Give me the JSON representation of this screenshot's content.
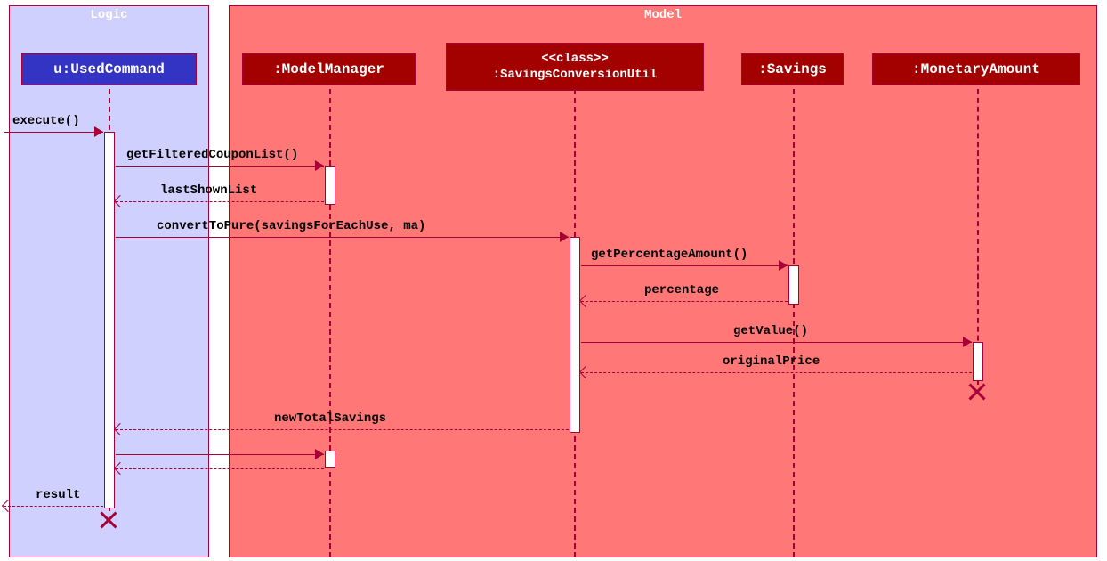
{
  "boxes": {
    "logic": {
      "title": "Logic"
    },
    "model": {
      "title": "Model"
    }
  },
  "participants": {
    "usedCommand": "u:UsedCommand",
    "modelManager": ":ModelManager",
    "savingsConvUtilStereo": "<<class>>",
    "savingsConvUtil": ":SavingsConversionUtil",
    "savings": ":Savings",
    "monetaryAmount": ":MonetaryAmount"
  },
  "messages": {
    "execute": "execute()",
    "getFiltered": "getFilteredCouponList()",
    "lastShown": "lastShownList",
    "convertToPure": "convertToPure(savingsForEachUse, ma)",
    "getPercentage": "getPercentageAmount()",
    "percentage": "percentage",
    "getValue": "getValue()",
    "originalPrice": "originalPrice",
    "newTotalSavings": "newTotalSavings",
    "result": "result"
  },
  "chart_data": {
    "type": "sequence-diagram",
    "boxes": [
      {
        "name": "Logic",
        "participants": [
          "u:UsedCommand"
        ]
      },
      {
        "name": "Model",
        "participants": [
          ":ModelManager",
          ":SavingsConversionUtil",
          ":Savings",
          ":MonetaryAmount"
        ]
      }
    ],
    "participants": [
      {
        "id": "U",
        "name": "u:UsedCommand"
      },
      {
        "id": "MM",
        "name": ":ModelManager"
      },
      {
        "id": "SCU",
        "name": ":SavingsConversionUtil",
        "stereotype": "<<class>>"
      },
      {
        "id": "S",
        "name": ":Savings"
      },
      {
        "id": "MA",
        "name": ":MonetaryAmount"
      }
    ],
    "messages": [
      {
        "from": "caller",
        "to": "U",
        "label": "execute()",
        "type": "call"
      },
      {
        "from": "U",
        "to": "MM",
        "label": "getFilteredCouponList()",
        "type": "call"
      },
      {
        "from": "MM",
        "to": "U",
        "label": "lastShownList",
        "type": "return"
      },
      {
        "from": "U",
        "to": "SCU",
        "label": "convertToPure(savingsForEachUse, ma)",
        "type": "call"
      },
      {
        "from": "SCU",
        "to": "S",
        "label": "getPercentageAmount()",
        "type": "call"
      },
      {
        "from": "S",
        "to": "SCU",
        "label": "percentage",
        "type": "return"
      },
      {
        "from": "SCU",
        "to": "MA",
        "label": "getValue()",
        "type": "call"
      },
      {
        "from": "MA",
        "to": "SCU",
        "label": "originalPrice",
        "type": "return"
      },
      {
        "from": "MA",
        "to": null,
        "type": "destroy"
      },
      {
        "from": "SCU",
        "to": "U",
        "label": "newTotalSavings",
        "type": "return"
      },
      {
        "from": "U",
        "to": "MM",
        "label": "",
        "type": "call"
      },
      {
        "from": "MM",
        "to": "U",
        "label": "",
        "type": "return"
      },
      {
        "from": "U",
        "to": "caller",
        "label": "result",
        "type": "return"
      },
      {
        "from": "U",
        "to": null,
        "type": "destroy"
      }
    ]
  }
}
